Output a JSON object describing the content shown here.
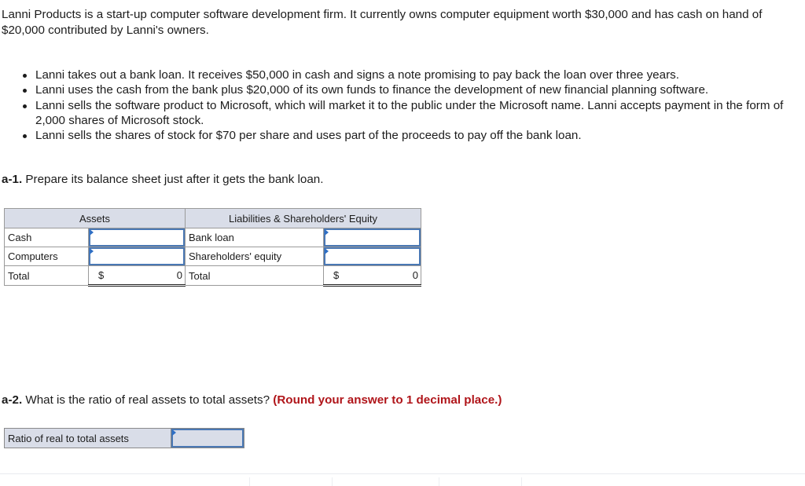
{
  "intro": "Lanni Products is a start-up computer software development firm. It currently owns computer equipment worth $30,000 and has cash on hand of $20,000 contributed by Lanni's owners.",
  "bullets": [
    "Lanni takes out a bank loan. It receives $50,000 in cash and signs a note promising to pay back the loan over three years.",
    "Lanni uses the cash from the bank plus $20,000 of its own funds to finance the development of new financial planning software.",
    "Lanni sells the software product to Microsoft, which will market it to the public under the Microsoft name. Lanni accepts payment in the form of 2,000 shares of Microsoft stock.",
    "Lanni sells the shares of stock for $70 per share and uses part of the proceeds to pay off the bank loan."
  ],
  "question_a1": {
    "label": "a-1.",
    "text": " Prepare its balance sheet just after it gets the bank loan."
  },
  "balance_sheet": {
    "assets_header": "Assets",
    "liabilities_header": "Liabilities & Shareholders' Equity",
    "rows": [
      {
        "asset_label": "Cash",
        "asset_value": "",
        "liab_label": "Bank loan",
        "liab_value": ""
      },
      {
        "asset_label": "Computers",
        "asset_value": "",
        "liab_label": "Shareholders' equity",
        "liab_value": ""
      }
    ],
    "total": {
      "asset_label": "Total",
      "asset_currency": "$",
      "asset_value": "0",
      "liab_label": "Total",
      "liab_currency": "$",
      "liab_value": "0"
    }
  },
  "question_a2": {
    "label": "a-2.",
    "text": " What is the ratio of real assets to total assets? ",
    "hint": "(Round your answer to 1 decimal place.)"
  },
  "ratio": {
    "label": "Ratio of real to total assets",
    "value": ""
  },
  "colors": {
    "hint_red": "#b0151a",
    "input_border": "#4a78b4",
    "header_bg": "#d9dde8"
  }
}
